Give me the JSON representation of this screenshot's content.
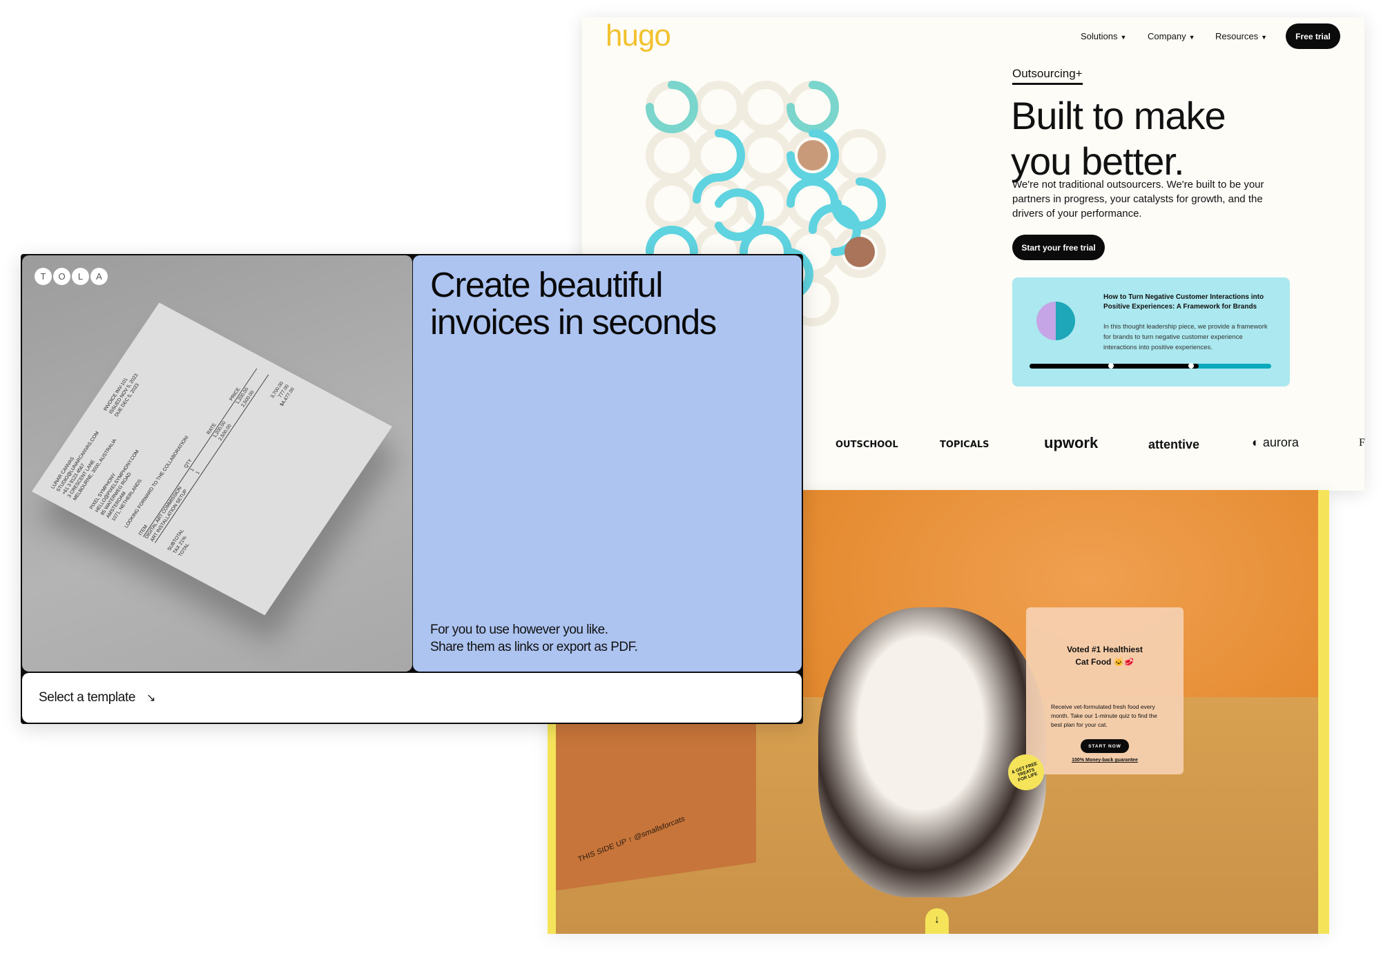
{
  "hugo": {
    "logo": "hugo",
    "nav": [
      {
        "label": "Solutions"
      },
      {
        "label": "Company"
      },
      {
        "label": "Resources"
      }
    ],
    "free_trial": "Free trial",
    "eyebrow": "Outsourcing+",
    "headline_1": "Built to make",
    "headline_2": "you better.",
    "body": "We're not traditional outsourcers. We're built to be your partners in progress, your catalysts for growth, and the drivers of your performance.",
    "cta": "Start your free trial",
    "card": {
      "title": "How to Turn Negative Customer Interactions into Positive Experiences: A Framework for Brands",
      "body": "In this thought leadership piece, we provide a framework for brands to turn negative customer experience interactions into positive experiences.",
      "progress_percent": 70
    },
    "logos": [
      "OUTSCHOOL",
      "TOPICALS",
      "upwork",
      "attentive",
      "aurora",
      "F"
    ],
    "colors": {
      "accent": "#f2c12e",
      "teal": "#5fd3e0",
      "card": "#abe8ef"
    }
  },
  "cat": {
    "promo_title_1": "Voted #1 Healthiest",
    "promo_title_2": "Cat Food 🐱🥩",
    "promo_body": "Receive vet-formulated fresh food every month. Take our 1-minute quiz to find the best plan for your cat.",
    "cta": "START NOW",
    "guarantee": "100% Money-back guarantee",
    "sticker": "& GET FREE TREATS FOR LIFE",
    "box_text": "THIS SIDE UP ↑   @smallsforcats",
    "scroll_icon": "↓"
  },
  "tola": {
    "logo_letters": [
      "T",
      "O",
      "L",
      "A"
    ],
    "headline_1": "Create beautiful",
    "headline_2": "invoices in seconds",
    "sub_1": "For you to use however you like.",
    "sub_2": "Share them as links or export as PDF.",
    "select_template": "Select a template",
    "arrow": "↘",
    "invoice": {
      "from": [
        "LUNAR CANVAS",
        "STUDIO@LUNARCANVAS.COM",
        "+61 3 9123 4567",
        "3 CRESCENT LANE",
        "MELBOURNE, 3000, AUSTRALIA"
      ],
      "meta": [
        "INVOICE INV-101",
        "ISSUED NOV 5, 2023",
        "DUE DEC 5, 2023"
      ],
      "to": [
        "PIXEL SYMPHONY",
        "HELLO@PIXELSYMPHONY.COM",
        "85 WATERWEG ROAD",
        "AMSTERDAM",
        "1071, NETHERLANDS"
      ],
      "note": "LOOKING FORWARD TO THE COLLABORATION!",
      "headers": [
        "ITEM",
        "QTY",
        "RATE",
        "PRICE"
      ],
      "items": [
        [
          "DIGITAL ART COMMISSION",
          "1",
          "1,200.00",
          "1,200.00"
        ],
        [
          "ART INSTALLATION SETUP",
          "1",
          "2,500.00",
          "2,500.00"
        ]
      ],
      "totals": [
        [
          "SUBTOTAL",
          "3,700.00"
        ],
        [
          "TAX 21%",
          "777.00"
        ],
        [
          "TOTAL",
          "$4,477.00"
        ]
      ]
    }
  }
}
